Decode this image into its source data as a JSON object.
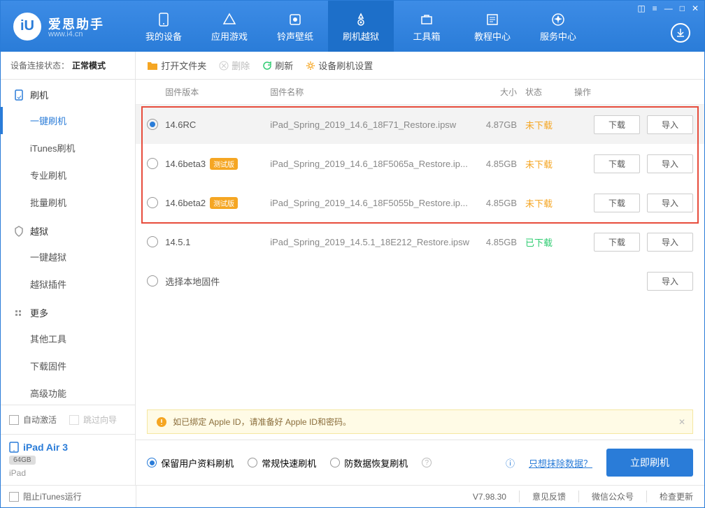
{
  "brand": {
    "name": "爱思助手",
    "url": "www.i4.cn"
  },
  "nav": {
    "items": [
      {
        "label": "我的设备"
      },
      {
        "label": "应用游戏"
      },
      {
        "label": "铃声壁纸"
      },
      {
        "label": "刷机越狱"
      },
      {
        "label": "工具箱"
      },
      {
        "label": "教程中心"
      },
      {
        "label": "服务中心"
      }
    ]
  },
  "connection": {
    "label": "设备连接状态：",
    "value": "正常模式"
  },
  "sidebar": {
    "g1": {
      "title": "刷机",
      "items": [
        "一键刷机",
        "iTunes刷机",
        "专业刷机",
        "批量刷机"
      ]
    },
    "g2": {
      "title": "越狱",
      "items": [
        "一键越狱",
        "越狱插件"
      ]
    },
    "g3": {
      "title": "更多",
      "items": [
        "其他工具",
        "下载固件",
        "高级功能"
      ]
    },
    "auto_activate": "自动激活",
    "skip_wizard": "跳过向导"
  },
  "device": {
    "name": "iPad Air 3",
    "storage": "64GB",
    "type": "iPad"
  },
  "toolbar": {
    "open": "打开文件夹",
    "delete": "删除",
    "refresh": "刷新",
    "settings": "设备刷机设置"
  },
  "table": {
    "head": {
      "ver": "固件版本",
      "name": "固件名称",
      "size": "大小",
      "status": "状态",
      "ops": "操作"
    },
    "download": "下载",
    "import": "导入",
    "rows": [
      {
        "ver": "14.6RC",
        "beta": false,
        "name": "iPad_Spring_2019_14.6_18F71_Restore.ipsw",
        "size": "4.87GB",
        "status": "未下载",
        "statusClass": "nd",
        "selected": true,
        "ops": true
      },
      {
        "ver": "14.6beta3",
        "beta": true,
        "name": "iPad_Spring_2019_14.6_18F5065a_Restore.ip...",
        "size": "4.85GB",
        "status": "未下载",
        "statusClass": "nd",
        "selected": false,
        "ops": true
      },
      {
        "ver": "14.6beta2",
        "beta": true,
        "name": "iPad_Spring_2019_14.6_18F5055b_Restore.ip...",
        "size": "4.85GB",
        "status": "未下载",
        "statusClass": "nd",
        "selected": false,
        "ops": true
      },
      {
        "ver": "14.5.1",
        "beta": false,
        "name": "iPad_Spring_2019_14.5.1_18E212_Restore.ipsw",
        "size": "4.85GB",
        "status": "已下载",
        "statusClass": "dd",
        "selected": false,
        "ops": true
      },
      {
        "ver": "选择本地固件",
        "beta": false,
        "name": "",
        "size": "",
        "status": "",
        "statusClass": "",
        "selected": false,
        "ops": false,
        "importOnly": true
      }
    ],
    "beta_tag": "测试版"
  },
  "notice": "如已绑定 Apple ID，请准备好 Apple ID和密码。",
  "actions": {
    "opts": [
      "保留用户资料刷机",
      "常规快速刷机",
      "防数据恢复刷机"
    ],
    "erase_link": "只想抹除数据？",
    "flash": "立即刷机"
  },
  "footer": {
    "block_itunes": "阻止iTunes运行",
    "version": "V7.98.30",
    "links": [
      "意见反馈",
      "微信公众号",
      "检查更新"
    ]
  }
}
